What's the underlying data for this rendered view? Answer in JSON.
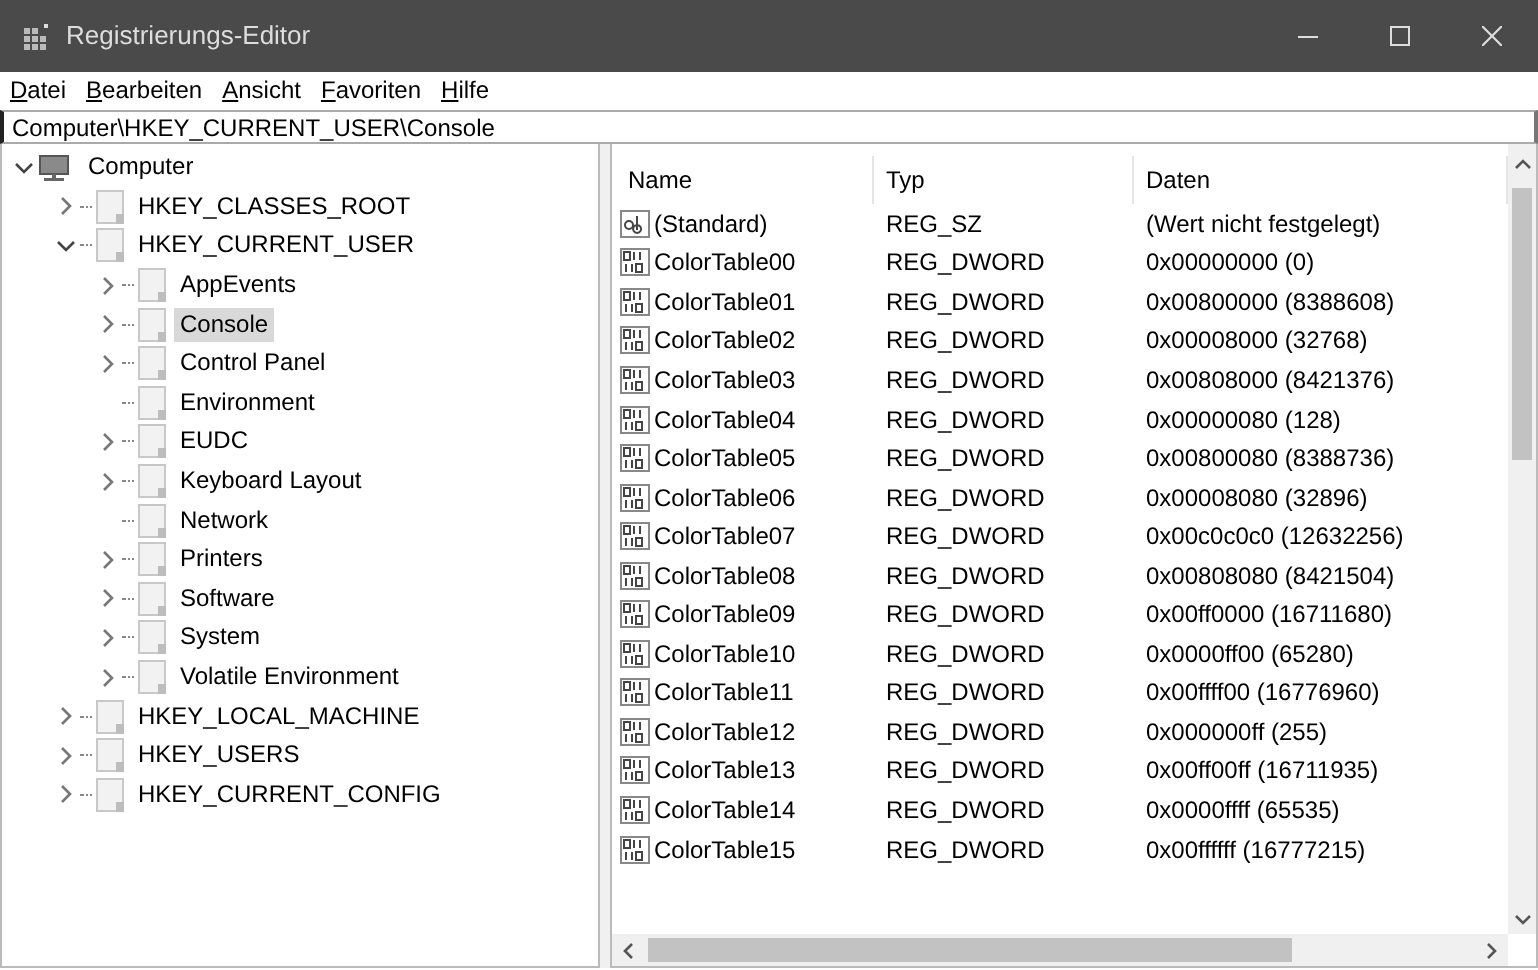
{
  "window": {
    "title": "Registrierungs-Editor"
  },
  "menu": [
    {
      "label": "Datei",
      "first_letter_underlined": true
    },
    {
      "label": "Bearbeiten",
      "first_letter_underlined": true
    },
    {
      "label": "Ansicht",
      "first_letter_underlined": true
    },
    {
      "label": "Favoriten",
      "first_letter_underlined": true
    },
    {
      "label": "Hilfe",
      "first_letter_underlined": true
    }
  ],
  "address": "Computer\\HKEY_CURRENT_USER\\Console",
  "tree": [
    {
      "label": "Computer",
      "kind": "computer",
      "expanded": true,
      "selected": false,
      "children": [
        {
          "label": "HKEY_CLASSES_ROOT",
          "expandable": true,
          "expanded": false,
          "selected": false
        },
        {
          "label": "HKEY_CURRENT_USER",
          "expandable": true,
          "expanded": true,
          "selected": false,
          "children": [
            {
              "label": "AppEvents",
              "expandable": true,
              "expanded": false,
              "selected": false
            },
            {
              "label": "Console",
              "expandable": true,
              "expanded": false,
              "selected": true
            },
            {
              "label": "Control Panel",
              "expandable": true,
              "expanded": false,
              "selected": false
            },
            {
              "label": "Environment",
              "selected": false
            },
            {
              "label": "EUDC",
              "expandable": true,
              "expanded": false,
              "selected": false
            },
            {
              "label": "Keyboard Layout",
              "expandable": true,
              "expanded": false,
              "selected": false
            },
            {
              "label": "Network",
              "selected": false
            },
            {
              "label": "Printers",
              "expandable": true,
              "expanded": false,
              "selected": false
            },
            {
              "label": "Software",
              "expandable": true,
              "expanded": false,
              "selected": false
            },
            {
              "label": "System",
              "expandable": true,
              "expanded": false,
              "selected": false
            },
            {
              "label": "Volatile Environment",
              "expandable": true,
              "expanded": false,
              "selected": false
            }
          ]
        },
        {
          "label": "HKEY_LOCAL_MACHINE",
          "expandable": true,
          "expanded": false,
          "selected": false
        },
        {
          "label": "HKEY_USERS",
          "expandable": true,
          "expanded": false,
          "selected": false
        },
        {
          "label": "HKEY_CURRENT_CONFIG",
          "expandable": true,
          "expanded": false,
          "selected": false
        }
      ]
    }
  ],
  "table": {
    "columns": [
      "Name",
      "Typ",
      "Daten"
    ],
    "rows": [
      {
        "kind": "string",
        "name": "(Standard)",
        "type": "REG_SZ",
        "data": "(Wert nicht festgelegt)"
      },
      {
        "kind": "binary",
        "name": "ColorTable00",
        "type": "REG_DWORD",
        "data": "0x00000000 (0)"
      },
      {
        "kind": "binary",
        "name": "ColorTable01",
        "type": "REG_DWORD",
        "data": "0x00800000 (8388608)"
      },
      {
        "kind": "binary",
        "name": "ColorTable02",
        "type": "REG_DWORD",
        "data": "0x00008000 (32768)"
      },
      {
        "kind": "binary",
        "name": "ColorTable03",
        "type": "REG_DWORD",
        "data": "0x00808000 (8421376)"
      },
      {
        "kind": "binary",
        "name": "ColorTable04",
        "type": "REG_DWORD",
        "data": "0x00000080 (128)"
      },
      {
        "kind": "binary",
        "name": "ColorTable05",
        "type": "REG_DWORD",
        "data": "0x00800080 (8388736)"
      },
      {
        "kind": "binary",
        "name": "ColorTable06",
        "type": "REG_DWORD",
        "data": "0x00008080 (32896)"
      },
      {
        "kind": "binary",
        "name": "ColorTable07",
        "type": "REG_DWORD",
        "data": "0x00c0c0c0 (12632256)"
      },
      {
        "kind": "binary",
        "name": "ColorTable08",
        "type": "REG_DWORD",
        "data": "0x00808080 (8421504)"
      },
      {
        "kind": "binary",
        "name": "ColorTable09",
        "type": "REG_DWORD",
        "data": "0x00ff0000 (16711680)"
      },
      {
        "kind": "binary",
        "name": "ColorTable10",
        "type": "REG_DWORD",
        "data": "0x0000ff00 (65280)"
      },
      {
        "kind": "binary",
        "name": "ColorTable11",
        "type": "REG_DWORD",
        "data": "0x00ffff00 (16776960)"
      },
      {
        "kind": "binary",
        "name": "ColorTable12",
        "type": "REG_DWORD",
        "data": "0x000000ff (255)"
      },
      {
        "kind": "binary",
        "name": "ColorTable13",
        "type": "REG_DWORD",
        "data": "0x00ff00ff (16711935)"
      },
      {
        "kind": "binary",
        "name": "ColorTable14",
        "type": "REG_DWORD",
        "data": "0x0000ffff (65535)"
      },
      {
        "kind": "binary",
        "name": "ColorTable15",
        "type": "REG_DWORD",
        "data": "0x00ffffff (16777215)"
      }
    ]
  }
}
